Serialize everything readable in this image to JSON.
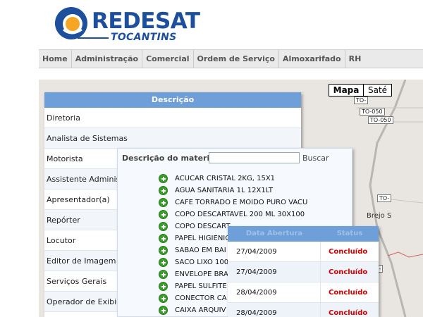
{
  "brand": {
    "name": "REDESAT",
    "sub": "TOCANTINS"
  },
  "nav": [
    "Home",
    "Administração",
    "Comercial",
    "Ordem de Serviço",
    "Almoxarifado",
    "RH"
  ],
  "map": {
    "btn_map": "Mapa",
    "btn_sat": "Saté",
    "road_labels": [
      "TO-",
      "TO-050",
      "TO-050",
      "TO-",
      "TO-"
    ],
    "place_label": "Brejo S"
  },
  "descricao": {
    "header": "Descrição",
    "rows": [
      "Diretoria",
      "Analista de Sistemas",
      "Motorista",
      "Assistente Administr",
      "Apresentador(a)",
      "Repórter",
      "Locutor",
      "Editor de Imagem",
      "Serviços Gerais",
      "Operador de Exibição"
    ]
  },
  "material": {
    "label": "Descrição do material",
    "input_value": "",
    "search_label": "Buscar",
    "items": [
      "ACUCAR CRISTAL 2KG, 15X1",
      "AGUA SANITARIA 1L 12X1LT",
      "CAFE TORRADO E MOIDO PURO VACU",
      "COPO DESCARTAVEL 200 ML 30X100",
      "COPO DESCART",
      "PAPEL HIGIENIC",
      "SABAO EM BAI",
      "SACO LIXO 100",
      "ENVELOPE BRA",
      "PAPEL SULFITE",
      "CONECTOR CA",
      "CAIXA ARQUIV"
    ]
  },
  "ordens": {
    "col_date": "Data Abertura",
    "col_status": "Status",
    "rows": [
      {
        "date": "27/04/2009",
        "status": "Concluído"
      },
      {
        "date": "27/04/2009",
        "status": "Concluído"
      },
      {
        "date": "28/04/2009",
        "status": "Concluído"
      },
      {
        "date": "28/04/2009",
        "status": "Concluído"
      }
    ]
  },
  "colors": {
    "brand_blue": "#1d4f9c",
    "table_header": "#6f9fd8",
    "status_red": "#d20000",
    "plus_green": "#3a9e2a"
  }
}
